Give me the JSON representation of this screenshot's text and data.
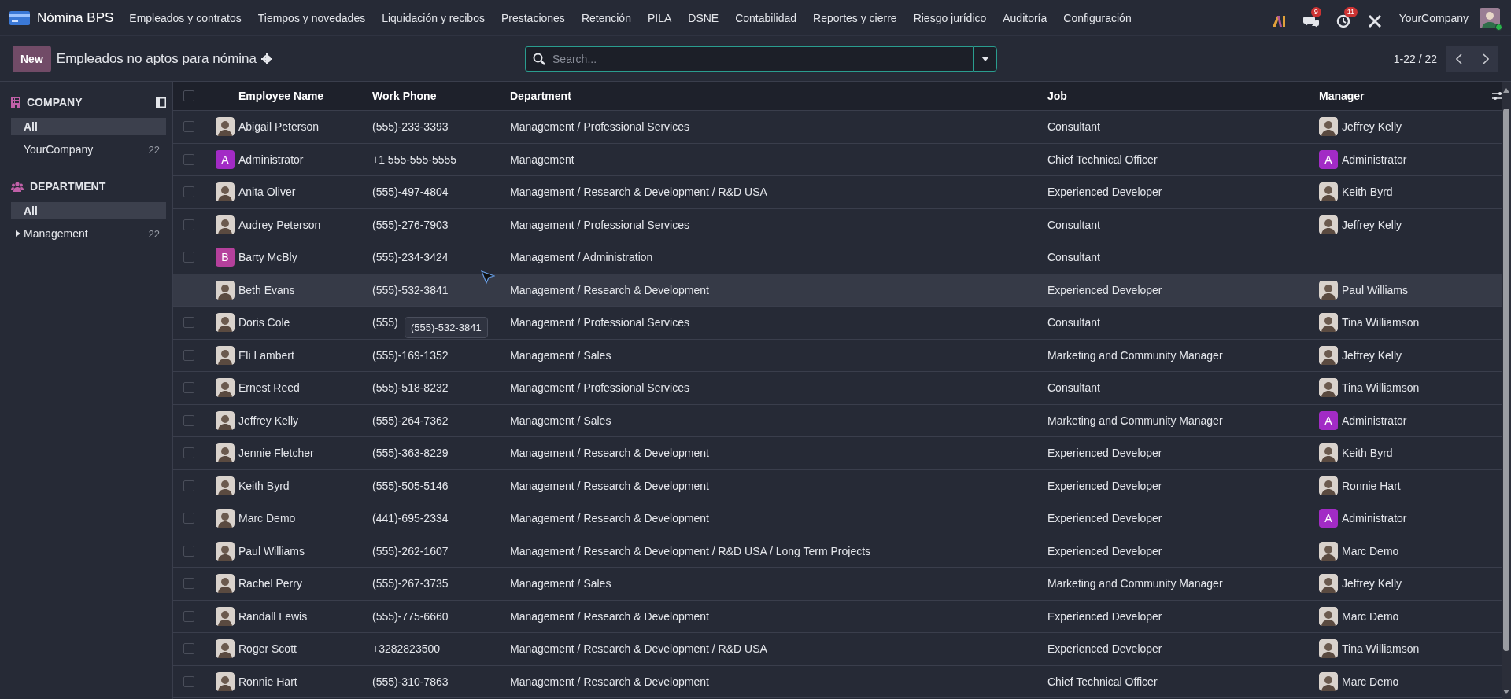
{
  "navbar": {
    "app_name": "Nómina BPS",
    "menu": [
      "Empleados y contratos",
      "Tiempos y novedades",
      "Liquidación y recibos",
      "Prestaciones",
      "Retención",
      "PILA",
      "DSNE",
      "Contabilidad",
      "Reportes y cierre",
      "Riesgo jurídico",
      "Auditoría",
      "Configuración"
    ],
    "chat_badge": "9",
    "activity_badge": "11",
    "company": "YourCompany"
  },
  "control_panel": {
    "new_button": "New",
    "title": "Empleados no aptos para nómina",
    "search_placeholder": "Search...",
    "pager": "1-22 / 22"
  },
  "sidebar": {
    "sections": [
      {
        "kind": "company",
        "title": "COMPANY",
        "items": [
          {
            "label": "All",
            "selected": true
          },
          {
            "label": "YourCompany",
            "count": "22",
            "selected": false
          }
        ]
      },
      {
        "kind": "department",
        "title": "DEPARTMENT",
        "items": [
          {
            "label": "All",
            "selected": true
          },
          {
            "label": "Management",
            "count": "22",
            "selected": false,
            "expanded": false
          }
        ]
      }
    ]
  },
  "table": {
    "select_all": {
      "checked": false
    },
    "columns": [
      "Employee Name",
      "Work Phone",
      "Department",
      "Job",
      "Manager"
    ],
    "rows": [
      {
        "avatar": {
          "kind": "photo"
        },
        "name": "Abigail Peterson",
        "phone": "(555)-233-3393",
        "department": "Management / Professional Services",
        "job": "Consultant",
        "manager": {
          "name": "Jeffrey Kelly",
          "avatar": {
            "kind": "photo"
          }
        },
        "hovered": false
      },
      {
        "avatar": {
          "kind": "letter",
          "letter": "A",
          "color": "#a22bc5"
        },
        "name": "Administrator",
        "phone": "+1 555-555-5555",
        "department": "Management",
        "job": "Chief Technical Officer",
        "manager": {
          "name": "Administrator",
          "avatar": {
            "kind": "letter",
            "letter": "A",
            "color": "#a22bc5"
          }
        },
        "hovered": false
      },
      {
        "avatar": {
          "kind": "photo"
        },
        "name": "Anita Oliver",
        "phone": "(555)-497-4804",
        "department": "Management / Research & Development / R&D USA",
        "job": "Experienced Developer",
        "manager": {
          "name": "Keith Byrd",
          "avatar": {
            "kind": "photo"
          }
        },
        "hovered": false
      },
      {
        "avatar": {
          "kind": "photo"
        },
        "name": "Audrey Peterson",
        "phone": "(555)-276-7903",
        "department": "Management / Professional Services",
        "job": "Consultant",
        "manager": {
          "name": "Jeffrey Kelly",
          "avatar": {
            "kind": "photo"
          }
        },
        "hovered": false
      },
      {
        "avatar": {
          "kind": "letter",
          "letter": "B",
          "color": "#b5409c"
        },
        "name": "Barty McBly",
        "phone": "(555)-234-3424",
        "department": "Management / Administration",
        "job": "Consultant",
        "hovered": false
      },
      {
        "avatar": {
          "kind": "photo"
        },
        "name": "Beth Evans",
        "phone": "(555)-532-3841",
        "department": "Management / Research & Development",
        "job": "Experienced Developer",
        "manager": {
          "name": "Paul Williams",
          "avatar": {
            "kind": "photo"
          }
        },
        "hovered": true
      },
      {
        "avatar": {
          "kind": "photo"
        },
        "name": "Doris Cole",
        "phone": "(555)",
        "department": "Management / Professional Services",
        "job": "Consultant",
        "manager": {
          "name": "Tina Williamson",
          "avatar": {
            "kind": "photo"
          }
        },
        "hovered": false
      },
      {
        "avatar": {
          "kind": "photo"
        },
        "name": "Eli Lambert",
        "phone": "(555)-169-1352",
        "department": "Management / Sales",
        "job": "Marketing and Community Manager",
        "manager": {
          "name": "Jeffrey Kelly",
          "avatar": {
            "kind": "photo"
          }
        },
        "hovered": false
      },
      {
        "avatar": {
          "kind": "photo"
        },
        "name": "Ernest Reed",
        "phone": "(555)-518-8232",
        "department": "Management / Professional Services",
        "job": "Consultant",
        "manager": {
          "name": "Tina Williamson",
          "avatar": {
            "kind": "photo"
          }
        },
        "hovered": false
      },
      {
        "avatar": {
          "kind": "photo"
        },
        "name": "Jeffrey Kelly",
        "phone": "(555)-264-7362",
        "department": "Management / Sales",
        "job": "Marketing and Community Manager",
        "manager": {
          "name": "Administrator",
          "avatar": {
            "kind": "letter",
            "letter": "A",
            "color": "#a22bc5"
          }
        },
        "hovered": false
      },
      {
        "avatar": {
          "kind": "photo"
        },
        "name": "Jennie Fletcher",
        "phone": "(555)-363-8229",
        "department": "Management / Research & Development",
        "job": "Experienced Developer",
        "manager": {
          "name": "Keith Byrd",
          "avatar": {
            "kind": "photo"
          }
        },
        "hovered": false
      },
      {
        "avatar": {
          "kind": "photo"
        },
        "name": "Keith Byrd",
        "phone": "(555)-505-5146",
        "department": "Management / Research & Development",
        "job": "Experienced Developer",
        "manager": {
          "name": "Ronnie Hart",
          "avatar": {
            "kind": "photo"
          }
        },
        "hovered": false
      },
      {
        "avatar": {
          "kind": "photo"
        },
        "name": "Marc Demo",
        "phone": "(441)-695-2334",
        "department": "Management / Research & Development",
        "job": "Experienced Developer",
        "manager": {
          "name": "Administrator",
          "avatar": {
            "kind": "letter",
            "letter": "A",
            "color": "#a22bc5"
          }
        },
        "hovered": false
      },
      {
        "avatar": {
          "kind": "photo"
        },
        "name": "Paul Williams",
        "phone": "(555)-262-1607",
        "department": "Management / Research & Development / R&D USA / Long Term Projects",
        "job": "Experienced Developer",
        "manager": {
          "name": "Marc Demo",
          "avatar": {
            "kind": "photo"
          }
        },
        "hovered": false
      },
      {
        "avatar": {
          "kind": "photo"
        },
        "name": "Rachel Perry",
        "phone": "(555)-267-3735",
        "department": "Management / Sales",
        "job": "Marketing and Community Manager",
        "manager": {
          "name": "Jeffrey Kelly",
          "avatar": {
            "kind": "photo"
          }
        },
        "hovered": false
      },
      {
        "avatar": {
          "kind": "photo"
        },
        "name": "Randall Lewis",
        "phone": "(555)-775-6660",
        "department": "Management / Research & Development",
        "job": "Experienced Developer",
        "manager": {
          "name": "Marc Demo",
          "avatar": {
            "kind": "photo"
          }
        },
        "hovered": false
      },
      {
        "avatar": {
          "kind": "photo"
        },
        "name": "Roger Scott",
        "phone": "+3282823500",
        "department": "Management / Research & Development / R&D USA",
        "job": "Experienced Developer",
        "manager": {
          "name": "Tina Williamson",
          "avatar": {
            "kind": "photo"
          }
        },
        "hovered": false
      },
      {
        "avatar": {
          "kind": "photo"
        },
        "name": "Ronnie Hart",
        "phone": "(555)-310-7863",
        "department": "Management / Research & Development",
        "job": "Chief Technical Officer",
        "manager": {
          "name": "Marc Demo",
          "avatar": {
            "kind": "photo"
          }
        },
        "hovered": false
      }
    ]
  },
  "tooltip": {
    "text": "(555)-532-3841"
  }
}
